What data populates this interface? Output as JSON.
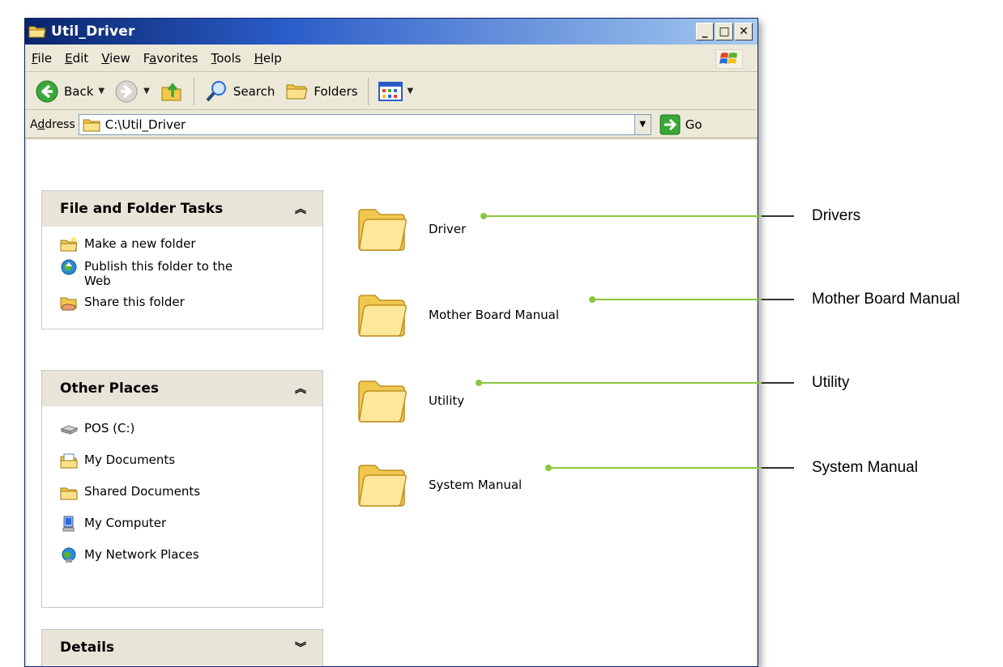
{
  "window": {
    "title": "Util_Driver",
    "caption_min": "_",
    "caption_max": "□",
    "caption_close": "✕"
  },
  "menu": [
    {
      "pre": "",
      "ul": "F",
      "post": "ile"
    },
    {
      "pre": "",
      "ul": "E",
      "post": "dit"
    },
    {
      "pre": "",
      "ul": "V",
      "post": "iew"
    },
    {
      "pre": "F",
      "ul": "a",
      "post": "vorites"
    },
    {
      "pre": "",
      "ul": "T",
      "post": "ools"
    },
    {
      "pre": "",
      "ul": "H",
      "post": "elp"
    }
  ],
  "toolbar": {
    "back_label": "Back",
    "search_label": "Search",
    "folders_label": "Folders"
  },
  "address": {
    "label_pre": "A",
    "label_ul": "d",
    "label_post": "dress",
    "value": "C:\\Util_Driver",
    "go_label": "Go"
  },
  "tasks_panel": {
    "title": "File and Folder Tasks",
    "chevron": "⌃",
    "items": [
      {
        "label": "Make a new folder"
      },
      {
        "label": "Publish this folder to the\nWeb"
      },
      {
        "label": "Share this folder"
      }
    ]
  },
  "places_panel": {
    "title": "Other Places",
    "items": [
      {
        "label": "POS (C:)"
      },
      {
        "label": "My Documents"
      },
      {
        "label": "Shared Documents"
      },
      {
        "label": "My Computer"
      },
      {
        "label": "My Network Places"
      }
    ]
  },
  "details_panel": {
    "title": "Details"
  },
  "folders": [
    {
      "name": "Driver"
    },
    {
      "name": "Mother Board Manual"
    },
    {
      "name": "Utility"
    },
    {
      "name": "System Manual"
    }
  ],
  "callouts": [
    {
      "label": "Drivers"
    },
    {
      "label": "Mother Board Manual"
    },
    {
      "label": "Utility"
    },
    {
      "label": "System Manual"
    }
  ],
  "colors": {
    "callout": "#8cc63f",
    "titlebar": "#0a246a"
  }
}
